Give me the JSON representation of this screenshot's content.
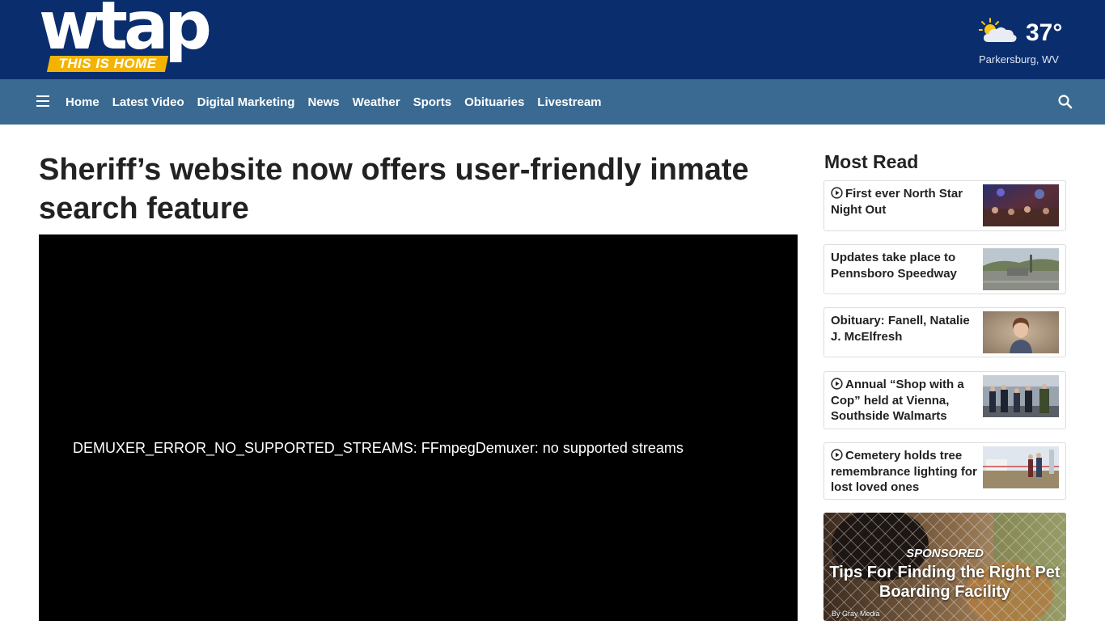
{
  "header": {
    "logo_text": "wtap",
    "logo_tagline": "THIS IS HOME",
    "weather": {
      "icon": "partly-cloudy-icon",
      "temperature": "37°",
      "location": "Parkersburg, WV"
    }
  },
  "nav": {
    "menu_icon": "hamburger-menu-icon",
    "items": [
      {
        "label": "Home"
      },
      {
        "label": "Latest Video"
      },
      {
        "label": "Digital Marketing"
      },
      {
        "label": "News"
      },
      {
        "label": "Weather"
      },
      {
        "label": "Sports"
      },
      {
        "label": "Obituaries"
      },
      {
        "label": "Livestream"
      }
    ],
    "search_icon": "search-icon"
  },
  "article": {
    "headline": "Sheriff’s website now offers user-friendly inmate search feature",
    "video_error": "DEMUXER_ERROR_NO_SUPPORTED_STREAMS: FFmpegDemuxer: no supported streams"
  },
  "sidebar": {
    "title": "Most Read",
    "items": [
      {
        "title": "First ever North Star Night Out",
        "has_video": true
      },
      {
        "title": "Updates take place to Pennsboro Speedway",
        "has_video": false
      },
      {
        "title": "Obituary: Fanell, Natalie J. McElfresh",
        "has_video": false
      },
      {
        "title": "Annual “Shop with a Cop” held at Vienna, Southside Walmarts",
        "has_video": true
      },
      {
        "title": "Cemetery holds tree remembrance lighting for lost loved ones",
        "has_video": true
      }
    ],
    "promo": {
      "label": "SPONSORED",
      "title": "Tips For Finding the Right Pet Boarding Facility",
      "byline": "By Gray Media"
    }
  },
  "colors": {
    "masthead": "#0a2d6e",
    "navbar": "#3a6a92",
    "logo_tag": "#f5b301",
    "player": "#000000"
  }
}
